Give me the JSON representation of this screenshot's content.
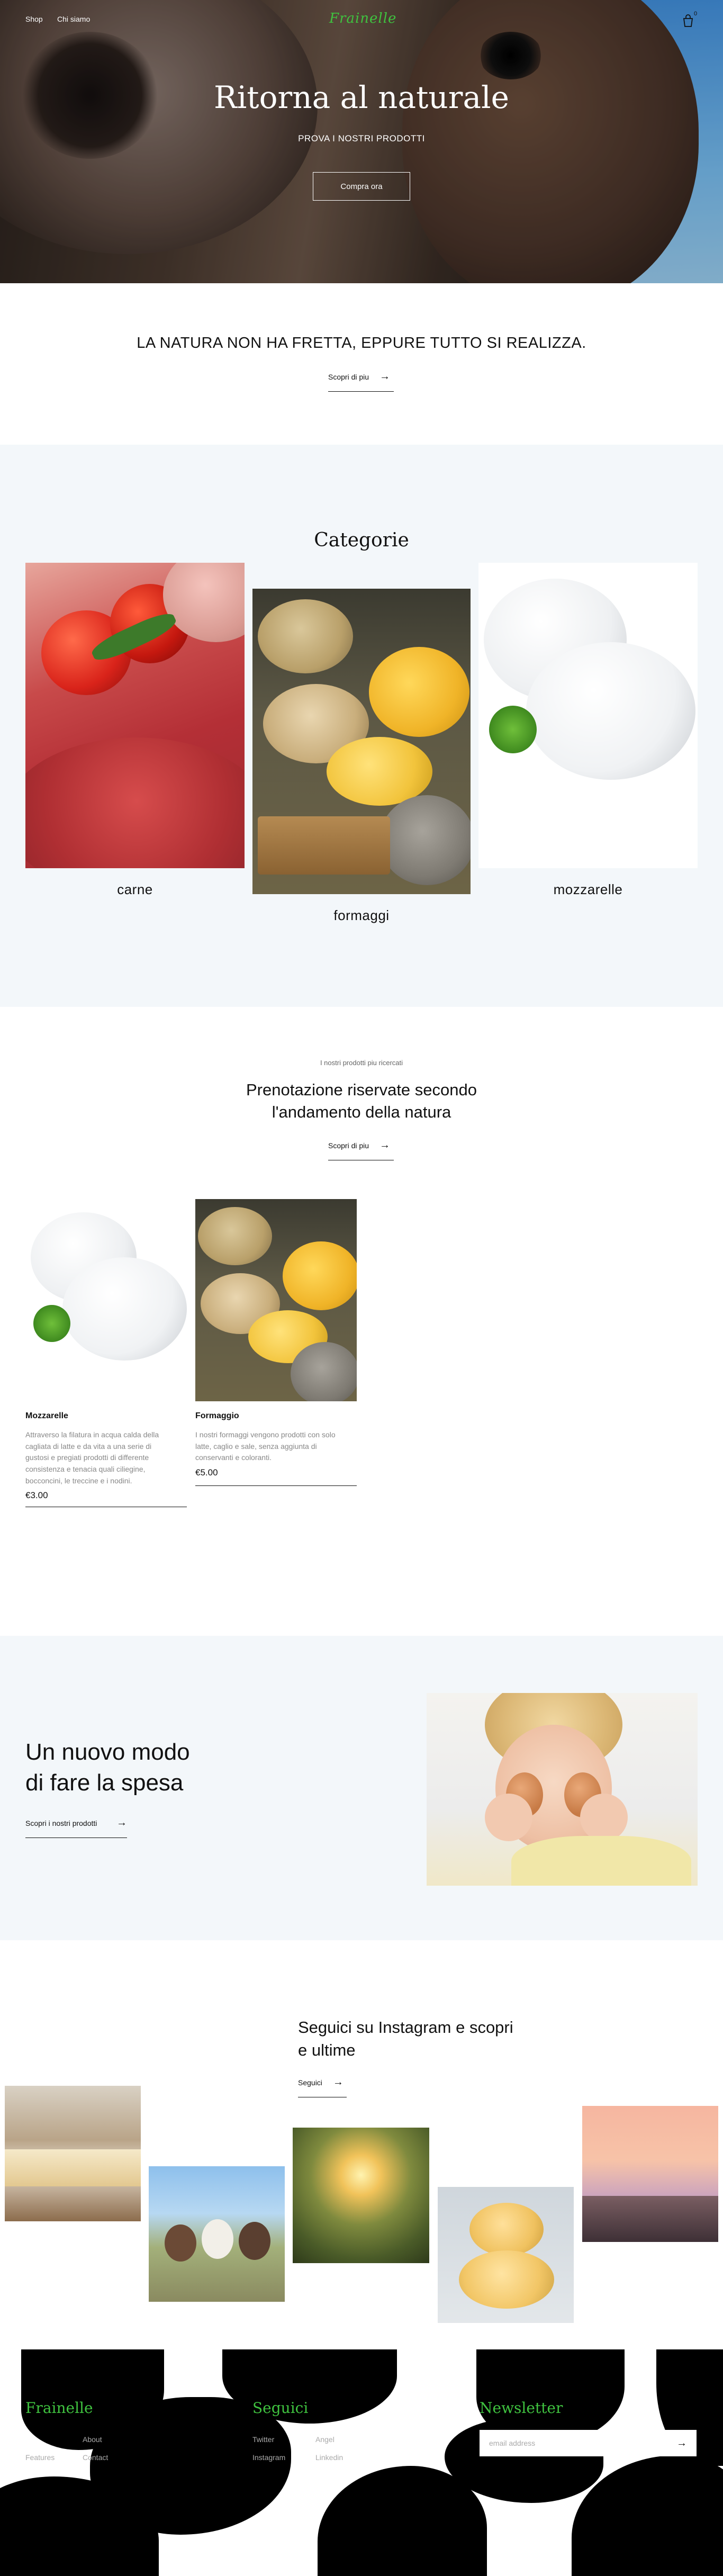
{
  "nav": {
    "links": [
      "Shop",
      "Chi siamo"
    ],
    "brand": "Frainelle",
    "cart_count": "0"
  },
  "hero": {
    "title": "Ritorna al naturale",
    "subtitle": "PROVA I NOSTRI PRODOTTI",
    "button": "Compra ora"
  },
  "quote": {
    "text": "LA NATURA NON HA FRETTA, EPPURE TUTTO SI REALIZZA.",
    "link": "Scopri di piu"
  },
  "categories": {
    "title": "Categorie",
    "items": [
      "carne",
      "formaggi",
      "mozzarelle"
    ]
  },
  "featured": {
    "eyebrow": "I nostri prodotti piu ricercati",
    "title_line1": "Prenotazione riservate secondo",
    "title_line2": "l'andamento della natura",
    "link": "Scopri di piu",
    "products": [
      {
        "name": "Mozzarelle",
        "desc_lines": [
          "Attraverso la filatura in acqua calda della",
          "cagliata di latte e da vita a una serie di",
          "gustosi e pregiati prodotti di differente",
          "consistenza e tenacia quali ciliegine,",
          "bocconcini, le treccine e i nodini."
        ],
        "price": "€3.00"
      },
      {
        "name": "Formaggio",
        "desc_lines": [
          "I nostri formaggi vengono prodotti con solo",
          "latte, caglio e sale, senza aggiunta di",
          "conservanti e coloranti."
        ],
        "price": "€5.00"
      }
    ]
  },
  "promo": {
    "title_line1": "Un nuovo modo",
    "title_line2": "di fare la spesa",
    "link": "Scopri i nostri prodotti"
  },
  "instagram": {
    "title_line1": "Seguici su Instagram e scopri",
    "title_line2": "e ultime",
    "link": "Seguici"
  },
  "footer": {
    "brand": "Frainelle",
    "col1": [
      "About",
      "Features",
      "Contact"
    ],
    "follow_title": "Seguici",
    "col2": [
      "Twitter",
      "Angel",
      "Instagram",
      "Linkedin"
    ],
    "newsletter_title": "Newsletter",
    "email_placeholder": "email address"
  }
}
